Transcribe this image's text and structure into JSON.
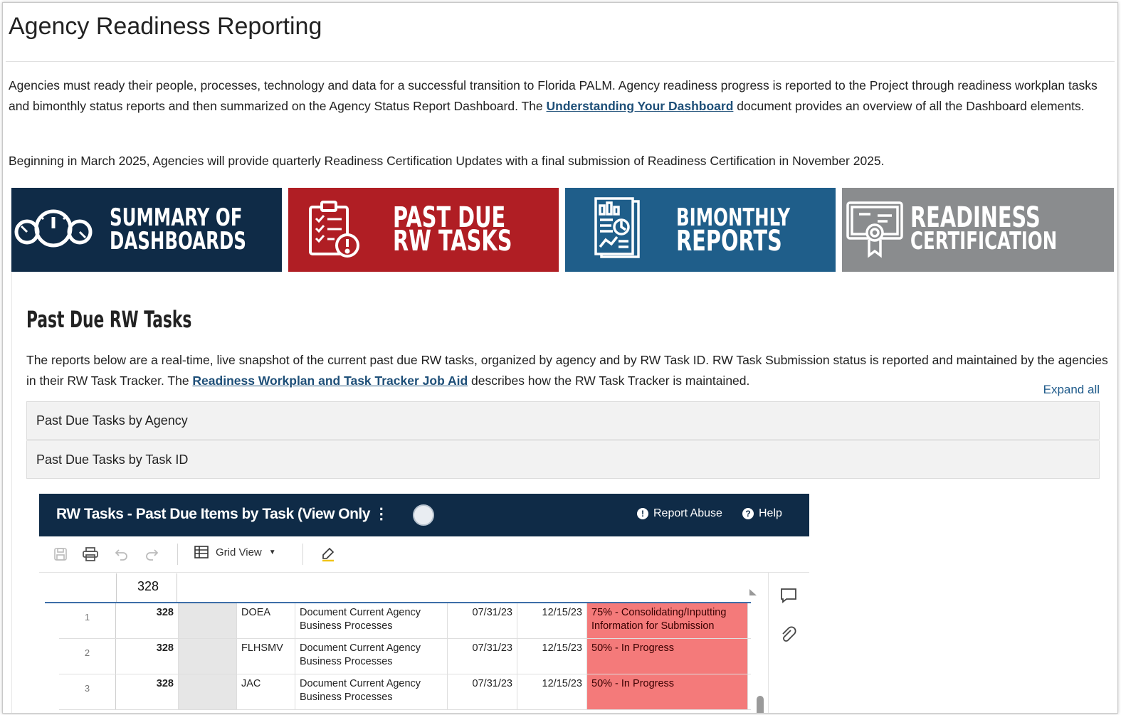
{
  "page": {
    "title": "Agency Readiness Reporting",
    "intro_part1": "Agencies must ready their people, processes, technology and data for a successful transition to Florida PALM. Agency readiness progress is reported to the Project through readiness workplan tasks and bimonthly status reports and then summarized on the Agency Status Report Dashboard. The ",
    "intro_link": "Understanding Your Dashboard",
    "intro_part2": " document provides an overview of all the Dashboard elements.",
    "intro2": "Beginning in March 2025, Agencies will provide quarterly Readiness Certification Updates with a final submission of Readiness Certification in November 2025."
  },
  "tiles": [
    {
      "line1": "SUMMARY OF",
      "line2": "DASHBOARDS",
      "color": "#0f2b47"
    },
    {
      "line1": "PAST DUE",
      "line2": "RW TASKS",
      "color": "#b01e24"
    },
    {
      "line1": "BIMONTHLY",
      "line2": "REPORTS",
      "color": "#1f5e8a"
    },
    {
      "line1": "READINESS",
      "line2": "CERTIFICATION",
      "color": "#8a8c8e"
    }
  ],
  "section": {
    "title": "Past Due RW Tasks",
    "desc_part1": "The reports below are a real-time, live snapshot of the current past due RW tasks, organized by agency and by RW Task ID. RW Task Submission status is reported and maintained by the agencies in their RW Task Tracker. The ",
    "desc_link": "Readiness Workplan and Task Tracker Job Aid",
    "desc_part2": " describes how the RW Task Tracker is maintained.",
    "expand_all": "Expand all",
    "accordions": [
      "Past Due Tasks by Agency",
      "Past Due Tasks by Task ID"
    ]
  },
  "embed": {
    "title": "RW Tasks - Past Due Items by Task (View Only",
    "report_abuse": "Report Abuse",
    "help": "Help",
    "grid_view": "Grid View",
    "header_id": "328",
    "rows": [
      {
        "num": "1",
        "id": "328",
        "agency": "DOEA",
        "task": "Document Current Agency Business Processes",
        "d1": "07/31/23",
        "d2": "12/15/23",
        "status": "75% - Consolidating/Inputting Information for Submission"
      },
      {
        "num": "2",
        "id": "328",
        "agency": "FLHSMV",
        "task": "Document Current Agency Business Processes",
        "d1": "07/31/23",
        "d2": "12/15/23",
        "status": "50% - In Progress"
      },
      {
        "num": "3",
        "id": "328",
        "agency": "JAC",
        "task": "Document Current Agency Business Processes",
        "d1": "07/31/23",
        "d2": "12/15/23",
        "status": "50% - In Progress"
      }
    ]
  }
}
